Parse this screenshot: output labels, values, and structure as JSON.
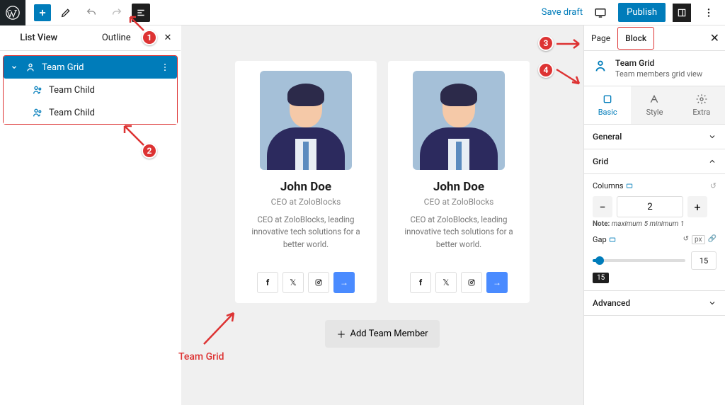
{
  "topbar": {
    "save_draft": "Save draft",
    "publish": "Publish"
  },
  "left_panel": {
    "tabs": {
      "list_view": "List View",
      "outline": "Outline"
    },
    "tree": [
      {
        "label": "Team Grid",
        "selected": true
      },
      {
        "label": "Team Child"
      },
      {
        "label": "Team Child"
      }
    ]
  },
  "canvas": {
    "cards": [
      {
        "name": "John Doe",
        "role": "CEO at ZoloBlocks",
        "desc": "CEO at ZoloBlocks, leading innovative tech solutions for a better world."
      },
      {
        "name": "John Doe",
        "role": "CEO at ZoloBlocks",
        "desc": "CEO at ZoloBlocks, leading innovative tech solutions for a better world."
      }
    ],
    "add_member": "Add Team Member"
  },
  "right_panel": {
    "tabs": {
      "page": "Page",
      "block": "Block"
    },
    "header": {
      "title": "Team Grid",
      "subtitle": "Team members grid view"
    },
    "subtabs": {
      "basic": "Basic",
      "style": "Style",
      "extra": "Extra"
    },
    "sections": {
      "general": "General",
      "grid": "Grid",
      "advanced": "Advanced"
    },
    "grid": {
      "columns_label": "Columns",
      "columns_value": "2",
      "note_prefix": "Note:",
      "note_text": "maximum 5 minimum 1",
      "gap_label": "Gap",
      "gap_unit": "px",
      "gap_value": "15",
      "tooltip": "15"
    }
  },
  "annotations": {
    "b1": "1",
    "b2": "2",
    "b3": "3",
    "b4": "4",
    "team_grid_label": "Team Grid"
  }
}
